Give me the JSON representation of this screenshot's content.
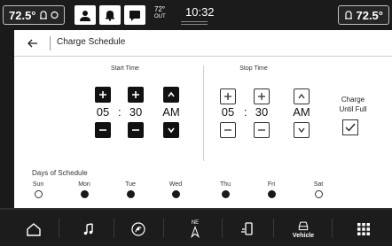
{
  "status_bar": {
    "left_temp": "72.5°",
    "right_temp": "72.5°",
    "outside_temp": "72°",
    "outside_label": "OUT",
    "time": "10:32"
  },
  "screen": {
    "title": "Charge Schedule",
    "back_icon": "back-arrow-icon"
  },
  "start_time": {
    "label": "Start Time",
    "hour": "05",
    "minute": "30",
    "period": "AM"
  },
  "stop_time": {
    "label": "Stop Time",
    "hour": "05",
    "minute": "30",
    "period": "AM"
  },
  "charge_until_full": {
    "label_line1": "Charge",
    "label_line2": "Until Full",
    "checked": true
  },
  "days": {
    "title": "Days of Schedule",
    "items": [
      {
        "label": "Sun",
        "selected": false
      },
      {
        "label": "Mon",
        "selected": true
      },
      {
        "label": "Tue",
        "selected": true
      },
      {
        "label": "Wed",
        "selected": true
      },
      {
        "label": "Thu",
        "selected": true
      },
      {
        "label": "Fri",
        "selected": true
      },
      {
        "label": "Sat",
        "selected": false
      }
    ]
  },
  "bottom_nav": {
    "items": [
      {
        "icon": "home-icon",
        "label": ""
      },
      {
        "icon": "music-note-icon",
        "label": ""
      },
      {
        "icon": "climate-icon",
        "label": ""
      },
      {
        "icon": "navigation-compass-icon",
        "label": "NE"
      },
      {
        "icon": "phone-icon",
        "label": ""
      },
      {
        "icon": "vehicle-icon",
        "label": "Vehicle"
      },
      {
        "icon": "apps-grid-icon",
        "label": ""
      }
    ]
  },
  "colors": {
    "bar_bg": "#1b1b1b",
    "content_bg": "#ffffff",
    "filled_button": "#111111"
  }
}
